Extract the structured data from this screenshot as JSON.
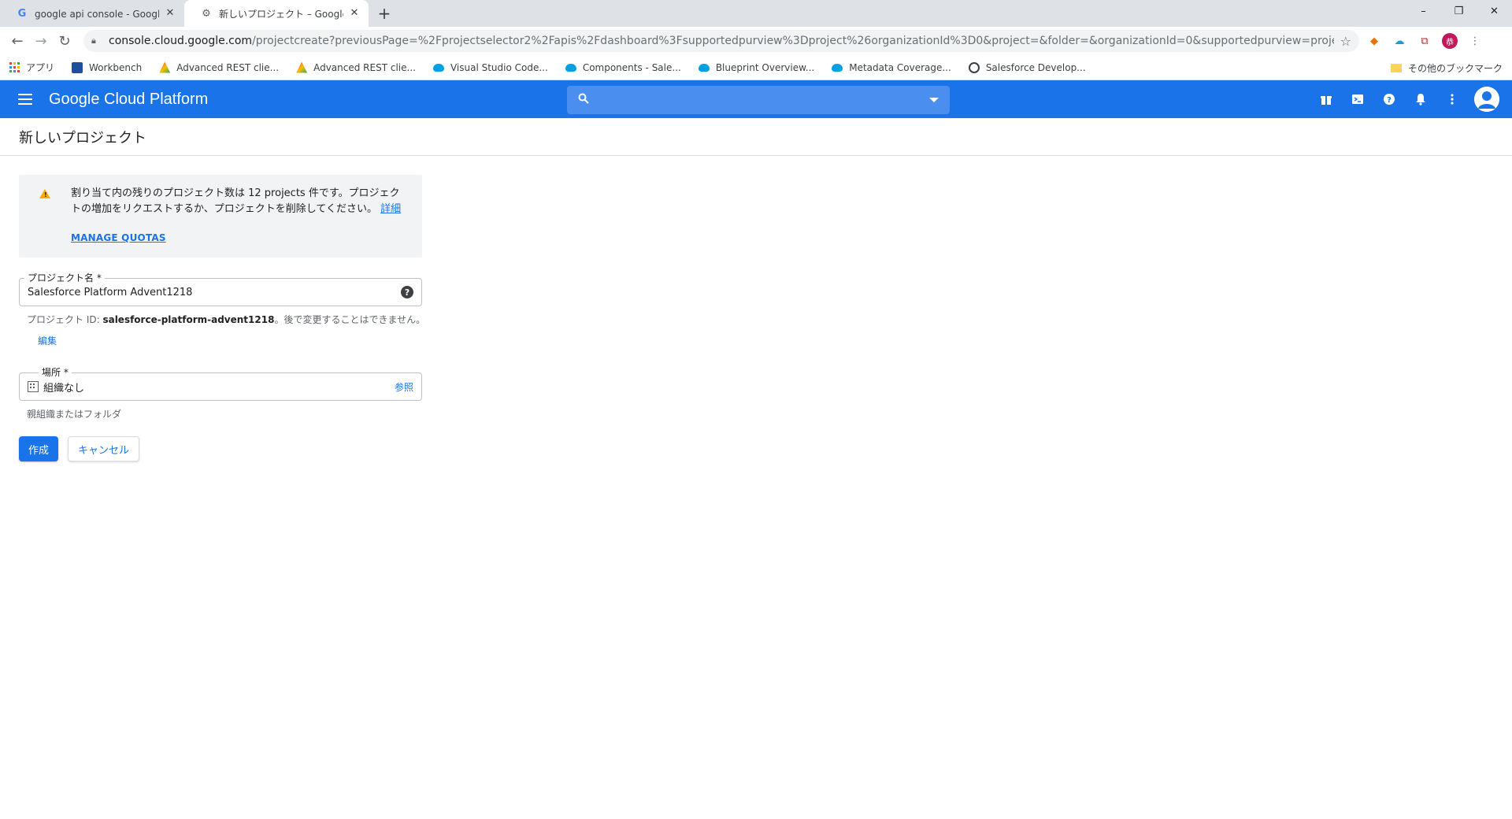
{
  "browser": {
    "tabs": [
      {
        "title": "google api console - Google 検索",
        "favicon": "google-g-icon",
        "active": false
      },
      {
        "title": "新しいプロジェクト – Google Cloud Platform",
        "favicon": "cloud-settings-icon",
        "active": true
      }
    ],
    "new_tab_label": "+",
    "window_controls": {
      "minimize": "–",
      "restore": "❐",
      "close": "✕"
    },
    "url_host": "console.cloud.google.com",
    "url_path": "/projectcreate?previousPage=%2Fprojectselector2%2Fapis%2Fdashboard%3Fsupportedpurview%3Dproject%26organizationId%3D0&project=&folder=&organizationId=0&supportedpurview=project",
    "profile_initial": "恭"
  },
  "bookmarks": {
    "apps_label": "アプリ",
    "items": [
      {
        "label": "Workbench",
        "icon": "workbench-cube-icon"
      },
      {
        "label": "Advanced REST clie...",
        "icon": "rest-client-icon"
      },
      {
        "label": "Advanced REST clie...",
        "icon": "rest-client-icon"
      },
      {
        "label": "Visual Studio Code...",
        "icon": "salesforce-cloud-icon"
      },
      {
        "label": "Components - Sale...",
        "icon": "salesforce-cloud-icon"
      },
      {
        "label": "Blueprint Overview...",
        "icon": "salesforce-cloud-icon"
      },
      {
        "label": "Metadata Coverage...",
        "icon": "salesforce-cloud-icon"
      },
      {
        "label": "Salesforce Develop...",
        "icon": "globe-icon"
      }
    ],
    "other_label": "その他のブックマーク"
  },
  "gcp": {
    "title": "Google Cloud Platform",
    "search_placeholder": ""
  },
  "page": {
    "title": "新しいプロジェクト",
    "notice": {
      "text": "割り当て内の残りのプロジェクト数は 12 projects 件です。プロジェクトの増加をリクエストするか、プロジェクトを削除してください。",
      "details_link": "詳細",
      "manage_quotas": "MANAGE QUOTAS"
    },
    "project_name": {
      "label": "プロジェクト名 *",
      "value": "Salesforce Platform Advent1218",
      "help": "?"
    },
    "project_id_hint": {
      "prefix": "プロジェクト ID: ",
      "id": "salesforce-platform-advent1218",
      "suffix": "。後で変更することはできません。"
    },
    "edit_link": "編集",
    "location": {
      "label": "場所 *",
      "value": "組織なし",
      "browse": "参照",
      "hint": "親組織またはフォルダ"
    },
    "buttons": {
      "create": "作成",
      "cancel": "キャンセル"
    }
  },
  "colors": {
    "gcp_blue": "#1a73e8",
    "warning": "#f9ab00"
  }
}
